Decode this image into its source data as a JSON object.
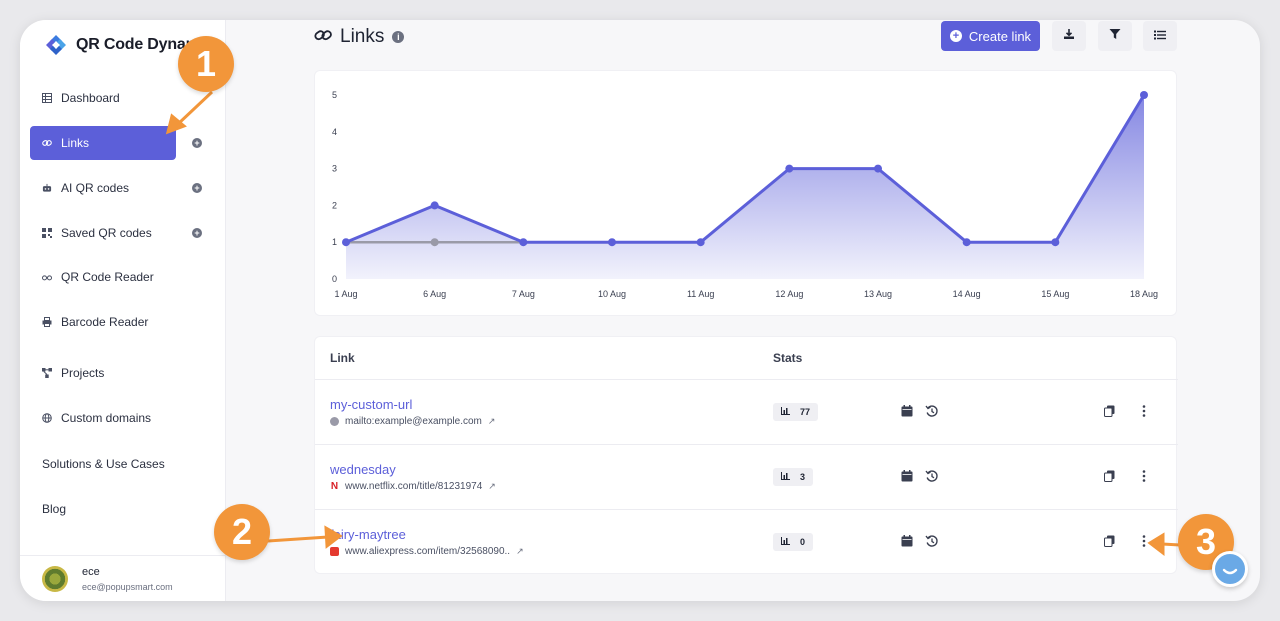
{
  "app": {
    "logo_text": "QR Code Dynamic"
  },
  "sidebar": {
    "items": [
      {
        "label": "Dashboard",
        "icon": "table-icon"
      },
      {
        "label": "Links",
        "icon": "link-icon",
        "active": true
      },
      {
        "label": "AI QR codes",
        "icon": "robot-icon"
      },
      {
        "label": "Saved QR codes",
        "icon": "qr-icon"
      },
      {
        "label": "QR Code Reader",
        "icon": "glasses-icon"
      },
      {
        "label": "Barcode Reader",
        "icon": "printer-icon"
      },
      {
        "label": "Projects",
        "icon": "diagram-icon"
      },
      {
        "label": "Custom domains",
        "icon": "globe-icon"
      }
    ],
    "solutions_label": "Solutions & Use Cases",
    "blog_label": "Blog",
    "user": {
      "name": "ece",
      "email": "ece@popupsmart.com"
    }
  },
  "header": {
    "title": "Links",
    "create_label": "Create link"
  },
  "colors": {
    "accent": "#5c5fd9",
    "annotation": "#f2963a",
    "chart_gray": "#9a9aa8"
  },
  "chart_data": {
    "type": "area",
    "categories": [
      "1 Aug",
      "6 Aug",
      "7 Aug",
      "10 Aug",
      "11 Aug",
      "12 Aug",
      "13 Aug",
      "14 Aug",
      "15 Aug",
      "18 Aug"
    ],
    "series": [
      {
        "values": [
          1,
          2,
          1,
          1,
          1,
          3,
          3,
          1,
          1,
          5
        ]
      },
      {
        "values": [
          1,
          1,
          1,
          null,
          null,
          null,
          null,
          null,
          null,
          null
        ]
      }
    ],
    "y_ticks": [
      0,
      1,
      2,
      3,
      4,
      5
    ],
    "ylim": [
      0,
      5
    ],
    "grid": false
  },
  "table": {
    "headers": {
      "link": "Link",
      "stats": "Stats"
    },
    "rows": [
      {
        "name": "my-custom-url",
        "destination": "mailto:example@example.com",
        "favicon": "mail-icon",
        "clicks": "77"
      },
      {
        "name": "wednesday",
        "destination": "www.netflix.com/title/81231974",
        "favicon": "netflix-icon",
        "clicks": "3"
      },
      {
        "name": "fairy-maytree",
        "destination": "www.aliexpress.com/item/32568090..",
        "favicon": "aliexpress-icon",
        "clicks": "0"
      }
    ]
  },
  "annotations": {
    "one": "1",
    "two": "2",
    "three": "3"
  }
}
